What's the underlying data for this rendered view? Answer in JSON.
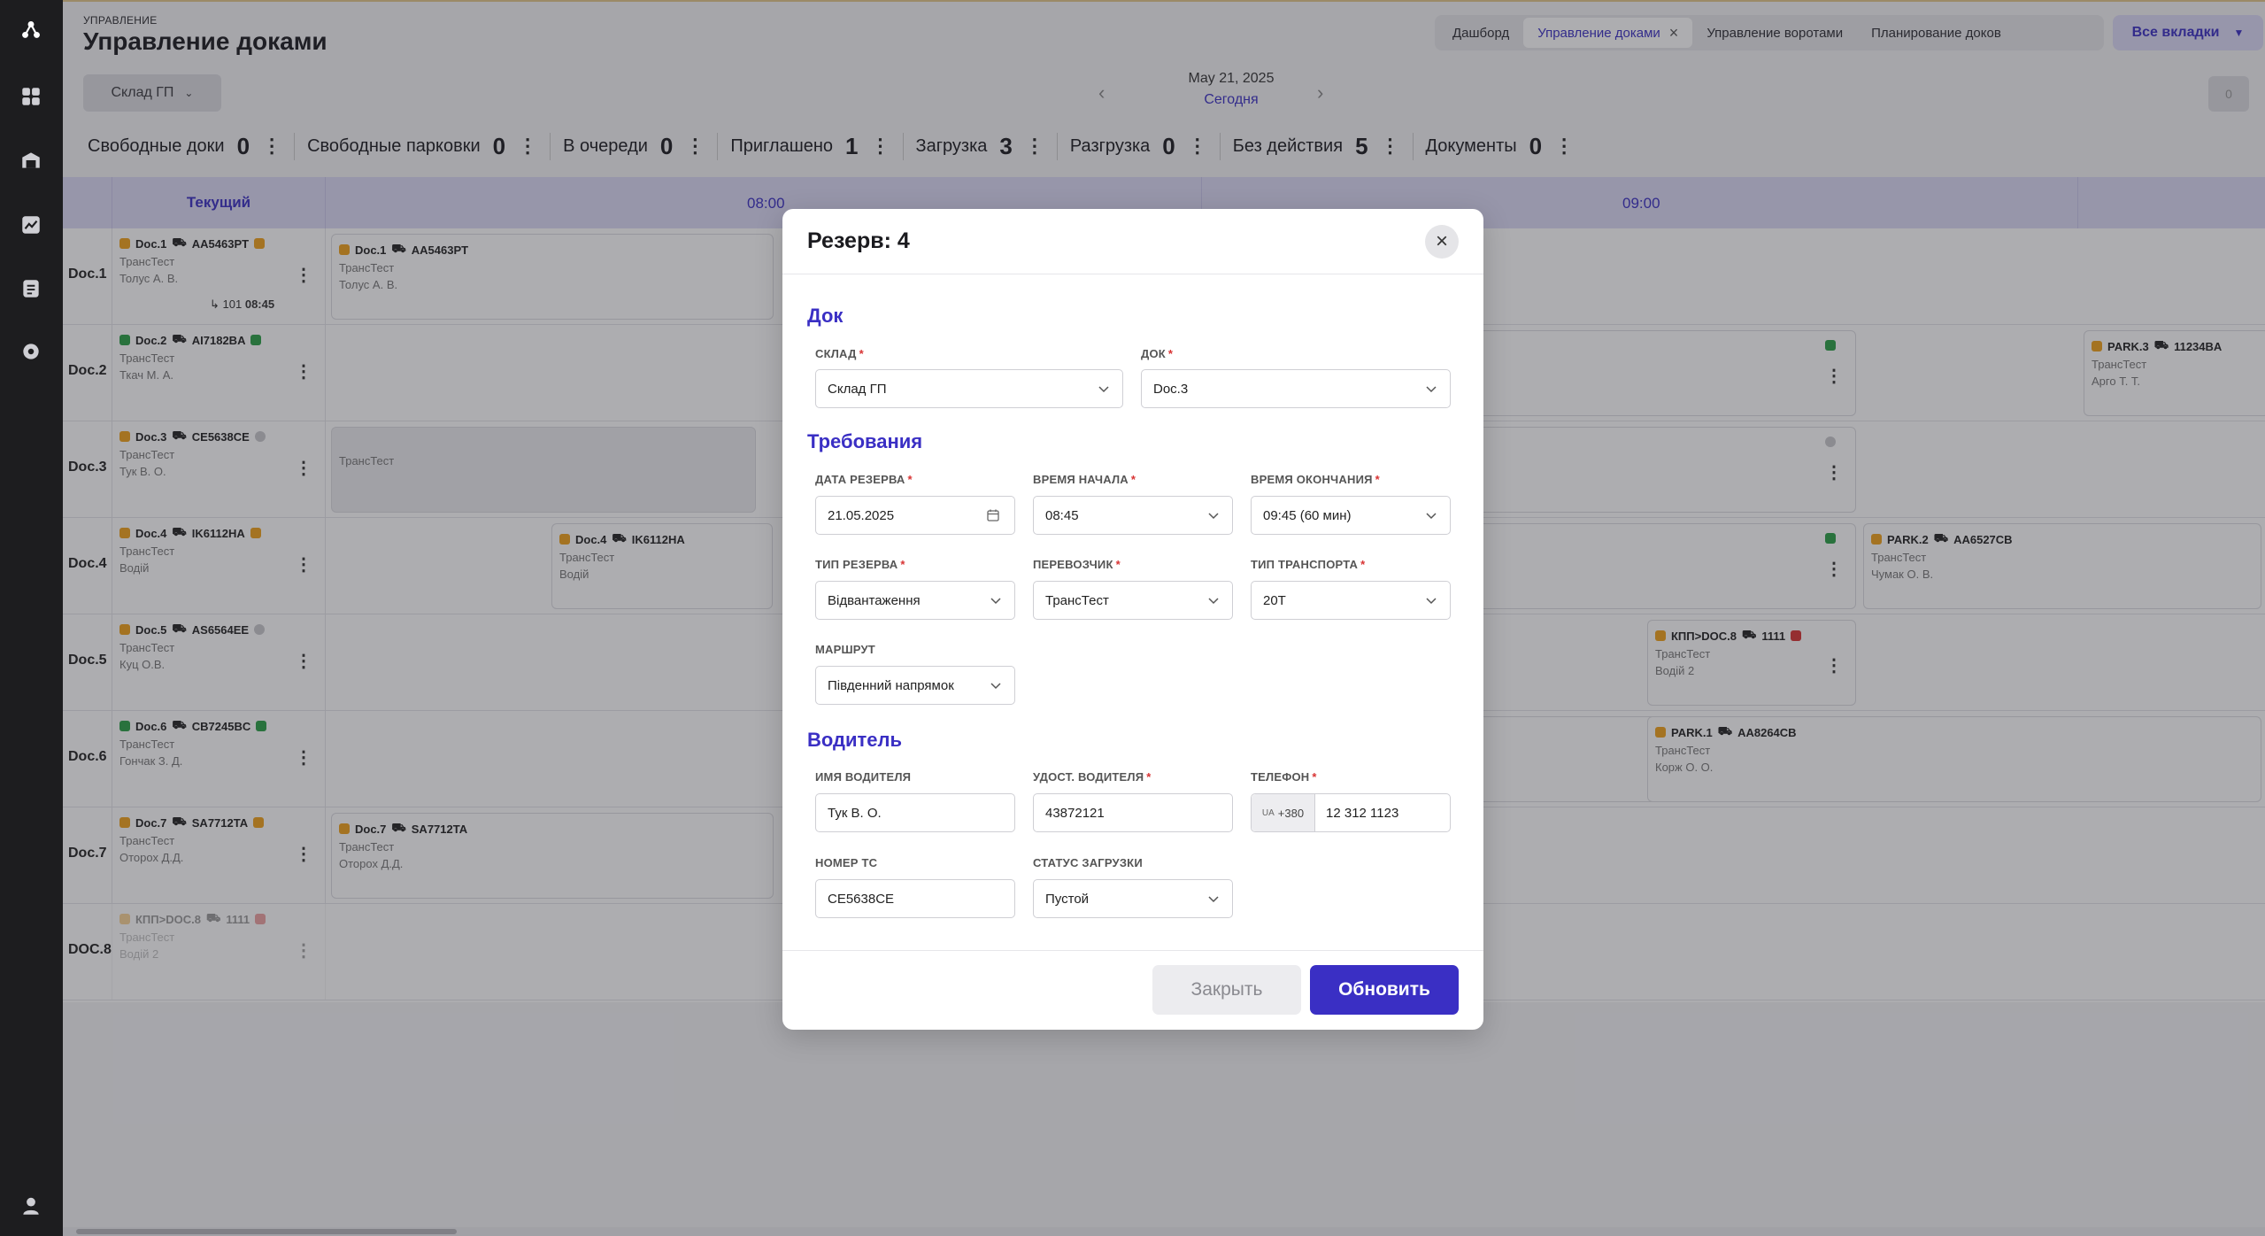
{
  "header": {
    "breadcrumb": "УПРАВЛЕНИЕ",
    "title": "Управление доками",
    "tabs": [
      {
        "label": "Дашборд"
      },
      {
        "label": "Управление доками"
      },
      {
        "label": "Управление воротами"
      },
      {
        "label": "Планирование доков"
      }
    ],
    "all_tabs": "Все вкладки"
  },
  "toolbar": {
    "warehouse": "Склад ГП",
    "date": "May 21, 2025",
    "today": "Сегодня",
    "right_count": "0"
  },
  "stats": [
    {
      "label": "Свободные доки",
      "value": "0"
    },
    {
      "label": "Свободные парковки",
      "value": "0"
    },
    {
      "label": "В очереди",
      "value": "0"
    },
    {
      "label": "Приглашено",
      "value": "1"
    },
    {
      "label": "Загрузка",
      "value": "3"
    },
    {
      "label": "Разгрузка",
      "value": "0"
    },
    {
      "label": "Без действия",
      "value": "5"
    },
    {
      "label": "Документы",
      "value": "0"
    }
  ],
  "schedule": {
    "current_col": "Текущий",
    "times": [
      "08:00",
      "09:00"
    ],
    "rows": [
      {
        "label": "Doc.1",
        "doc": "Doc.1",
        "plate": "AA5463PT",
        "carrier": "ТрансТест",
        "driver": "Толус А. В.",
        "extra_num": "101",
        "extra_time": "08:45"
      },
      {
        "label": "Doc.2",
        "doc": "Doc.2",
        "plate": "AI7182BA",
        "carrier": "ТрансТест",
        "driver": "Ткач М. А."
      },
      {
        "label": "Doc.3",
        "doc": "Doc.3",
        "plate": "CE5638CE",
        "carrier": "ТрансТест",
        "driver": "Тук В. О."
      },
      {
        "label": "Doc.4",
        "doc": "Doc.4",
        "plate": "IK6112HA",
        "carrier": "ТрансТест",
        "driver": "Водій"
      },
      {
        "label": "Doc.5",
        "doc": "Doc.5",
        "plate": "AS6564EE",
        "carrier": "ТрансТест",
        "driver": "Куц О.В."
      },
      {
        "label": "Doc.6",
        "doc": "Doc.6",
        "plate": "CB7245BC",
        "carrier": "ТрансТест",
        "driver": "Гончак З. Д."
      },
      {
        "label": "Doc.7",
        "doc": "Doc.7",
        "plate": "SA7712TA",
        "carrier": "ТрансТест",
        "driver": "Оторох Д.Д."
      },
      {
        "label": "DOC.8",
        "doc": "КПП>DOC.8",
        "plate": "1111",
        "carrier": "ТрансТест",
        "driver": "Водій 2"
      }
    ],
    "timeline_cards": {
      "doc1": {
        "doc": "Doc.1",
        "plate": "AA5463PT",
        "carrier": "ТрансТест",
        "driver": "Толус А. В."
      },
      "doc3": {
        "carrier": "ТрансТест"
      },
      "doc4": {
        "doc": "Doc.4",
        "plate": "IK6112HA",
        "carrier": "ТрансТест",
        "driver": "Водій"
      },
      "doc7": {
        "doc": "Doc.7",
        "plate": "SA7712TA",
        "carrier": "ТрансТест",
        "driver": "Оторох Д.Д."
      },
      "park3": {
        "doc": "PARK.3",
        "plate": "11234BA",
        "carrier": "ТрансТест",
        "driver": "Арго Т. Т."
      },
      "park2": {
        "doc": "PARK.2",
        "plate": "AA6527CB",
        "carrier": "ТрансТест",
        "driver": "Чумак О. В."
      },
      "kpp8": {
        "doc": "КПП>DOC.8",
        "plate": "1111",
        "carrier": "ТрансТест",
        "driver": "Водій 2"
      },
      "park1": {
        "doc": "PARK.1",
        "plate": "AA8264CB",
        "carrier": "ТрансТест",
        "driver": "Корж О. О."
      }
    }
  },
  "modal": {
    "title": "Резерв: 4",
    "section_dock": "Док",
    "warehouse_label": "СКЛАД",
    "warehouse_value": "Склад ГП",
    "dock_label": "ДОК",
    "dock_value": "Doc.3",
    "section_req": "Требования",
    "date_label": "ДАТА РЕЗЕРВА",
    "date_value": "21.05.2025",
    "start_label": "ВРЕМЯ НАЧАЛА",
    "start_value": "08:45",
    "end_label": "ВРЕМЯ ОКОНЧАНИЯ",
    "end_value": "09:45 (60 мин)",
    "type_label": "ТИП РЕЗЕРВА",
    "type_value": "Відвантаження",
    "carrier_label": "ПЕРЕВОЗЧИК",
    "carrier_value": "ТрансТест",
    "transport_label": "ТИП ТРАНСПОРТА",
    "transport_value": "20Т",
    "route_label": "МАРШРУТ",
    "route_value": "Південний напрямок",
    "section_driver": "Водитель",
    "driver_name_label": "ИМЯ ВОДИТЕЛЯ",
    "driver_name_value": "Тук В. О.",
    "license_label": "УДОСТ. ВОДИТЕЛЯ",
    "license_value": "43872121",
    "phone_label": "ТЕЛЕФОН",
    "phone_country": "UA",
    "phone_prefix": "+380",
    "phone_value": "12 312 1123",
    "vehicle_label": "НОМЕР ТС",
    "vehicle_value": "CE5638CE",
    "load_status_label": "СТАТУС ЗАГРУЗКИ",
    "load_status_value": "Пустой",
    "close_label": "Закрыть",
    "update_label": "Обновить"
  },
  "colors": {
    "accent": "#3a2fc4",
    "required": "#d83333"
  }
}
